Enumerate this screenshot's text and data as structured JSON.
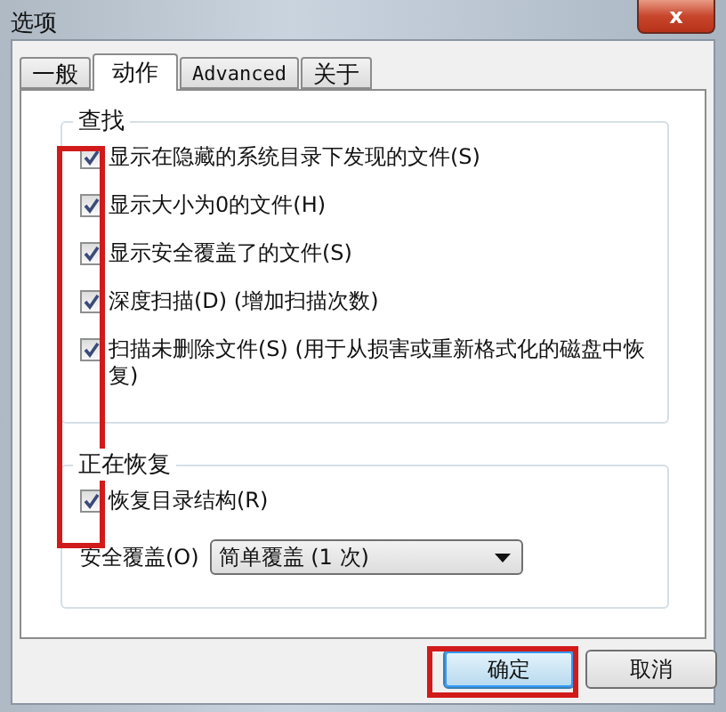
{
  "window": {
    "title": "选项",
    "close": "x"
  },
  "tabs": [
    {
      "label": "一般",
      "selected": false
    },
    {
      "label": "动作",
      "selected": true
    },
    {
      "label": "Advanced",
      "selected": false
    },
    {
      "label": "关于",
      "selected": false
    }
  ],
  "groups": [
    {
      "title": "查找",
      "options": [
        {
          "label": "显示在隐藏的系统目录下发现的文件(S)",
          "checked": true
        },
        {
          "label": "显示大小为0的文件(H)",
          "checked": true
        },
        {
          "label": "显示安全覆盖了的文件(S)",
          "checked": true
        },
        {
          "label": "深度扫描(D) (增加扫描次数)",
          "checked": true
        },
        {
          "label": "扫描未删除文件(S) (用于从损害或重新格式化的磁盘中恢复)",
          "checked": true
        }
      ]
    },
    {
      "title": "正在恢复",
      "options": [
        {
          "label": "恢复目录结构(R)",
          "checked": true
        }
      ],
      "select": {
        "label": "安全覆盖(O)",
        "value": "简单覆盖 (1 次)"
      }
    }
  ],
  "buttons": [
    "确定",
    "取消"
  ]
}
